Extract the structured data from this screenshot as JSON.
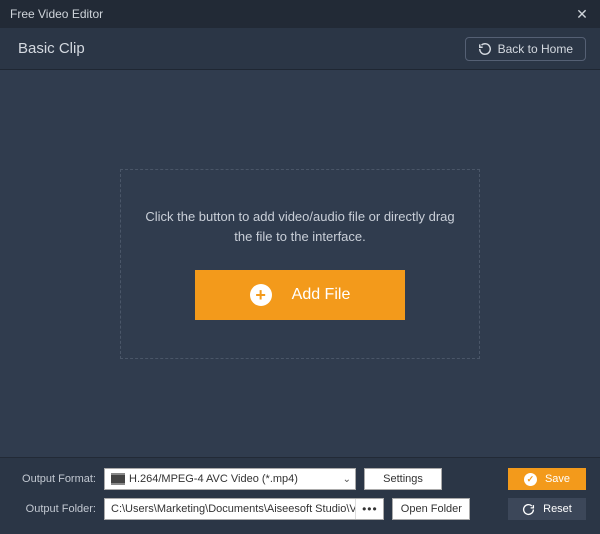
{
  "titlebar": {
    "title": "Free Video Editor"
  },
  "subheader": {
    "title": "Basic Clip",
    "back_label": "Back to Home"
  },
  "dropzone": {
    "hint": "Click the button to add video/audio file or directly drag the file to the interface.",
    "add_file_label": "Add File"
  },
  "footer": {
    "format_label": "Output Format:",
    "format_value": "H.264/MPEG-4 AVC Video (*.mp4)",
    "settings_label": "Settings",
    "folder_label": "Output Folder:",
    "folder_value": "C:\\Users\\Marketing\\Documents\\Aiseesoft Studio\\Video",
    "open_folder_label": "Open Folder",
    "save_label": "Save",
    "reset_label": "Reset",
    "browse_dots": "•••"
  },
  "colors": {
    "accent": "#f39a1b"
  }
}
